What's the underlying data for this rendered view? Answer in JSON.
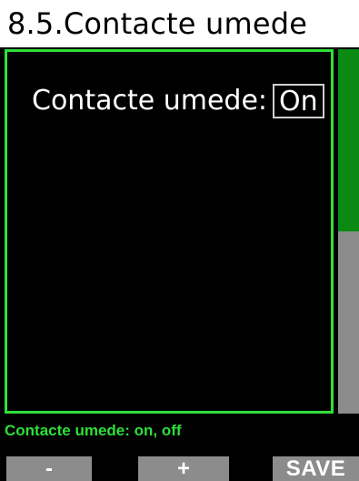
{
  "header": {
    "title": "8.5.Contacte umede"
  },
  "setting": {
    "label": "Contacte umede:",
    "value": "On"
  },
  "hint": {
    "text": "Contacte umede: on, off"
  },
  "softkeys": {
    "minus": "-",
    "plus": "+",
    "save": "SAVE"
  },
  "scroll": {
    "position_fraction": 0.5
  },
  "colors": {
    "accent": "#2fdf39",
    "thumb": "#0a8a12",
    "track": "#8c8c8c",
    "background": "#000000",
    "header": "#ffffff"
  }
}
